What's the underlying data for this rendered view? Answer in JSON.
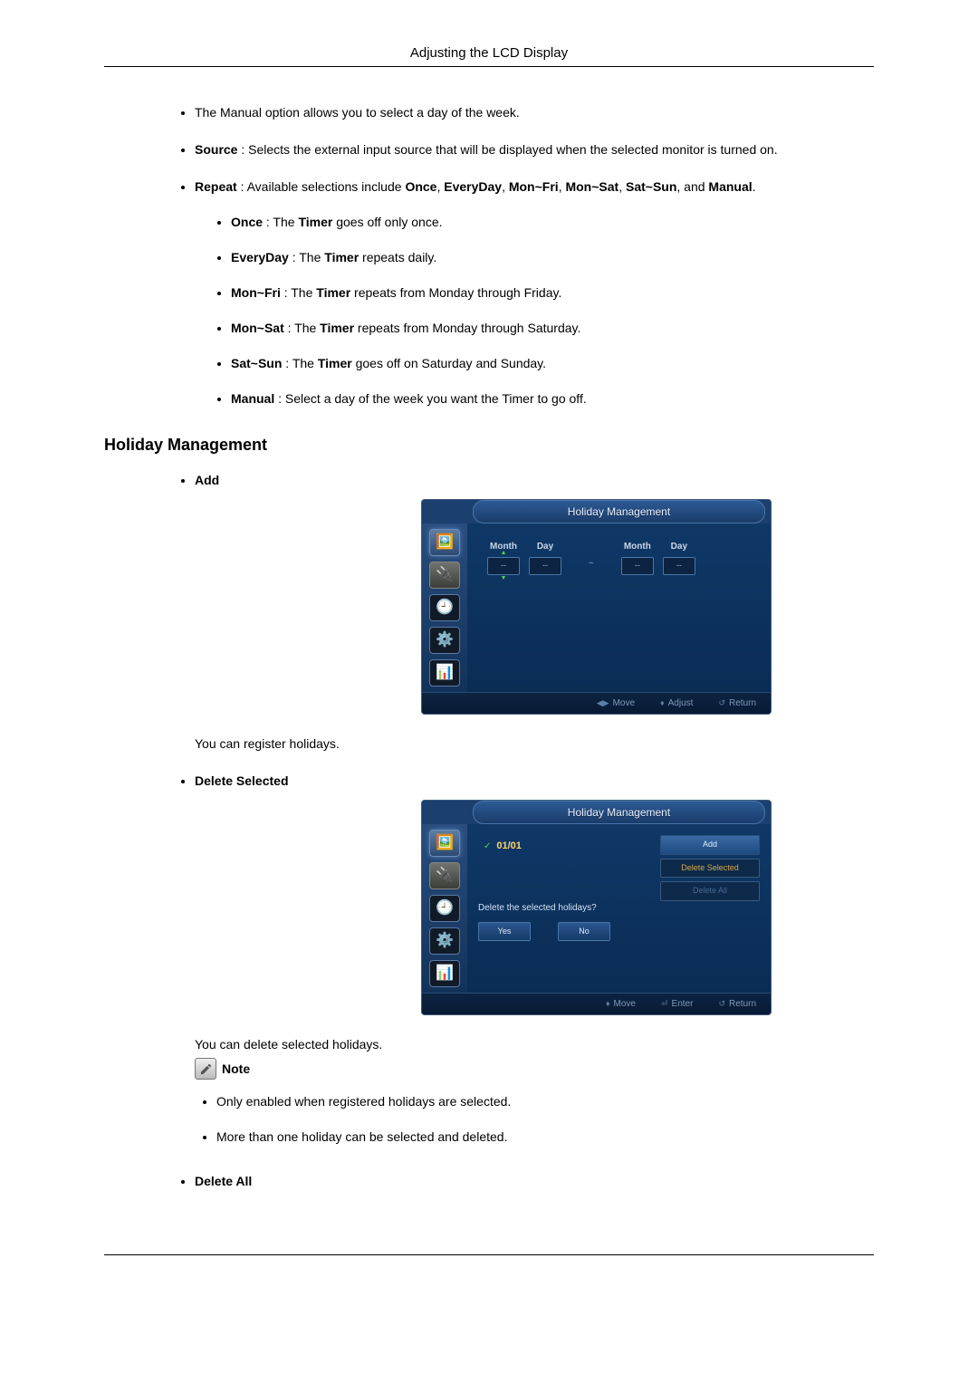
{
  "header": {
    "title": "Adjusting the LCD Display"
  },
  "intro": {
    "manual": "The Manual option allows you to select a day of the week.",
    "source_label": "Source",
    "source_text": " : Selects the external input source that will be displayed when the selected monitor is turned on.",
    "repeat_label": "Repeat",
    "repeat_pre": " : Available selections include ",
    "repeat_opts": [
      "Once",
      "EveryDay",
      "Mon~Fri",
      "Mon~Sat",
      "Sat~Sun"
    ],
    "repeat_and": ", and ",
    "repeat_manual": "Manual",
    "dot": "."
  },
  "repeat_items": [
    {
      "name": "Once",
      "desc": " : The ",
      "b": "Timer",
      "tail": " goes off only once."
    },
    {
      "name": "EveryDay",
      "desc": " : The ",
      "b": "Timer",
      "tail": " repeats daily."
    },
    {
      "name": "Mon~Fri",
      "desc": " : The ",
      "b": "Timer",
      "tail": " repeats from Monday through Friday."
    },
    {
      "name": "Mon~Sat",
      "desc": " : The ",
      "b": "Timer",
      "tail": " repeats from Monday through Saturday."
    },
    {
      "name": "Sat~Sun",
      "desc": " : The ",
      "b": "Timer",
      "tail": " goes off on Saturday and Sunday."
    },
    {
      "name": "Manual",
      "desc": " : Select a day of the week you want the Timer to go off.",
      "b": "",
      "tail": ""
    }
  ],
  "section": {
    "title": "Holiday Management"
  },
  "add": {
    "label": "Add",
    "osd_title": "Holiday Management",
    "col_month": "Month",
    "col_day": "Day",
    "val_dash": "--",
    "dash": "~",
    "footer": {
      "move": "Move",
      "adjust": "Adjust",
      "return": "Return"
    },
    "desc": "You can register holidays."
  },
  "delete_selected": {
    "label": "Delete Selected",
    "osd_title": "Holiday Management",
    "holiday_date": "01/01",
    "menu": {
      "add": "Add",
      "del_sel": "Delete Selected",
      "del_all": "Delete All"
    },
    "confirm_text": "Delete the selected holidays?",
    "yes": "Yes",
    "no": "No",
    "footer": {
      "move": "Move",
      "enter": "Enter",
      "return": "Return"
    },
    "desc": "You can delete selected holidays."
  },
  "note": {
    "label": "Note"
  },
  "note_items": [
    "Only enabled when registered holidays are selected.",
    "More than one holiday can be selected and deleted."
  ],
  "delete_all": {
    "label": "Delete All"
  }
}
